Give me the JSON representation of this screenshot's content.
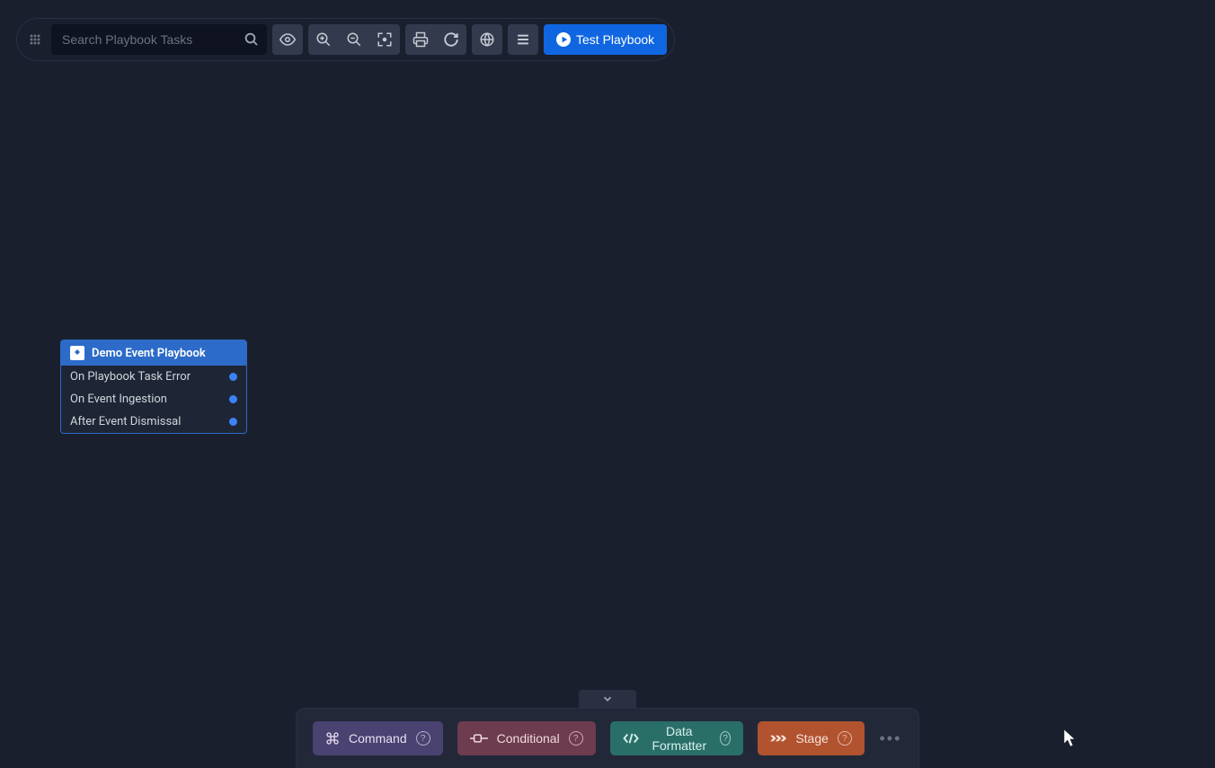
{
  "toolbar": {
    "search_placeholder": "Search Playbook Tasks",
    "test_label": "Test Playbook"
  },
  "node": {
    "title": "Demo Event Playbook",
    "rows": [
      {
        "label": "On Playbook Task Error"
      },
      {
        "label": "On Event Ingestion"
      },
      {
        "label": "After Event Dismissal"
      }
    ]
  },
  "palette": {
    "command": "Command",
    "conditional": "Conditional",
    "formatter": "Data Formatter",
    "stage": "Stage"
  }
}
